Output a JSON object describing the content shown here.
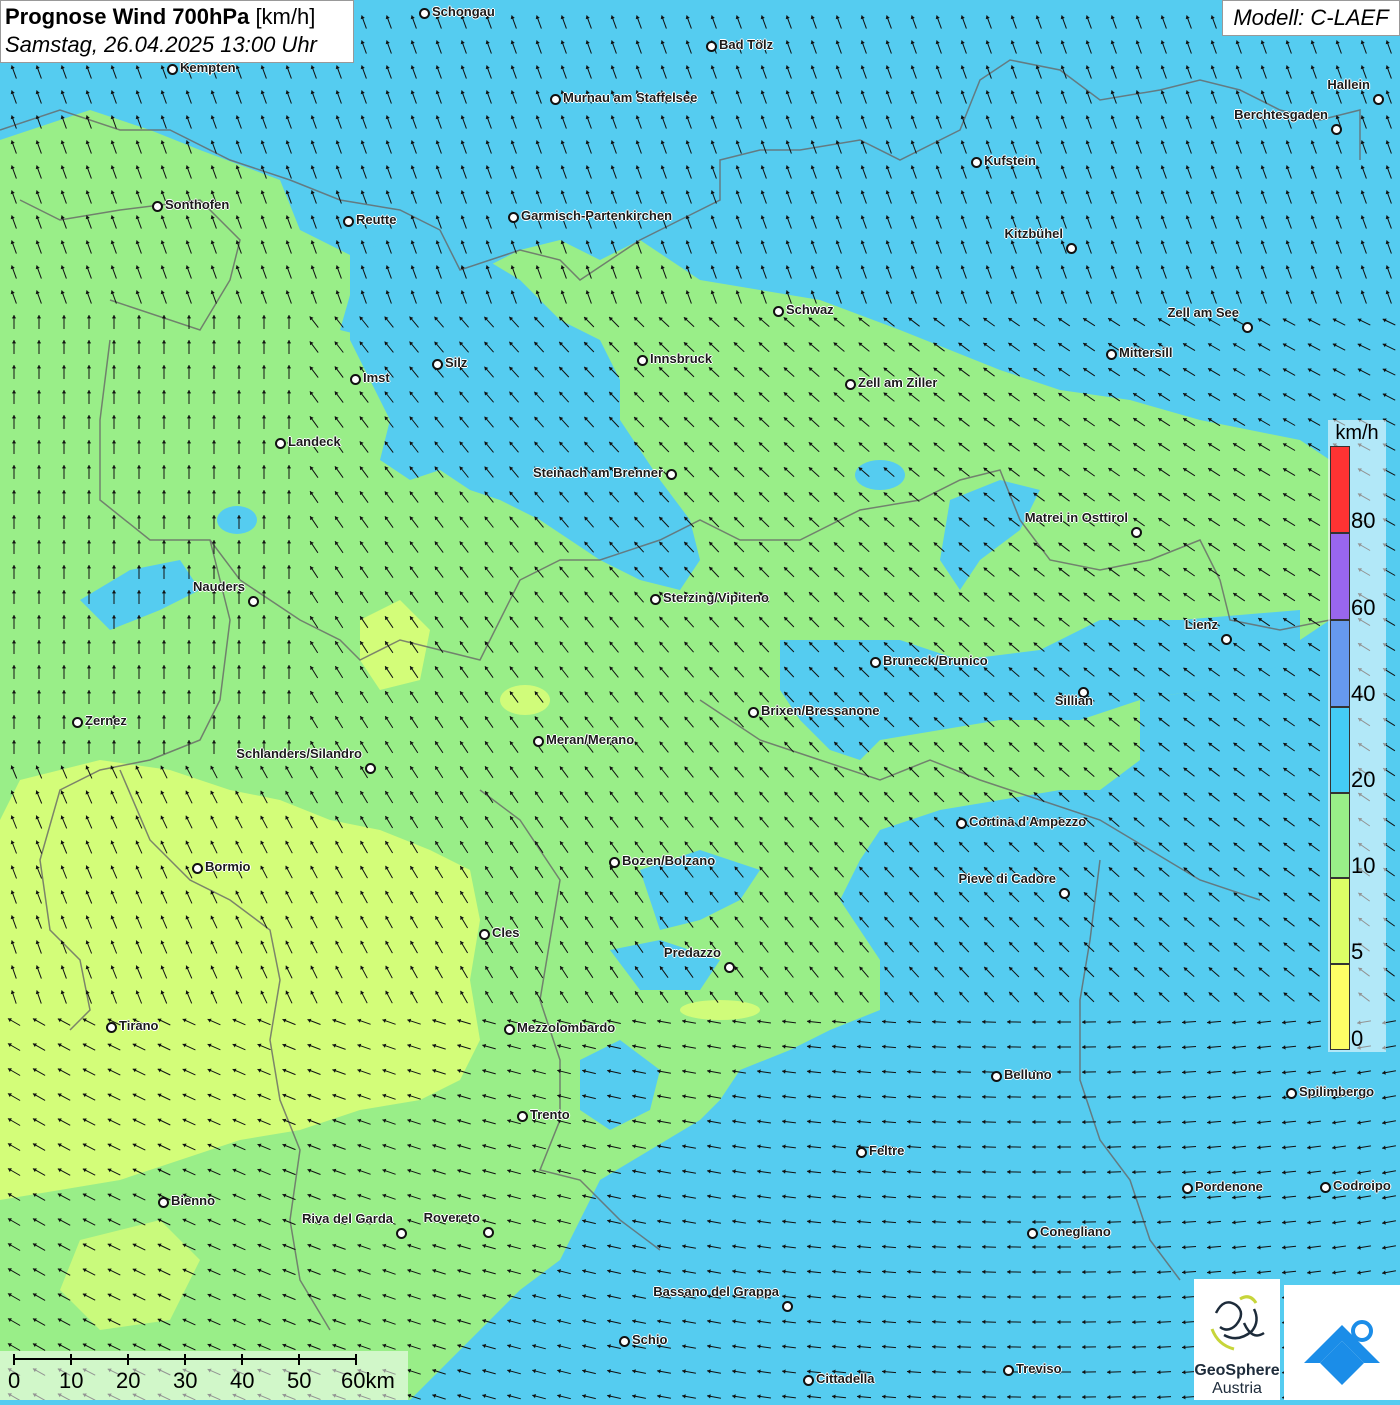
{
  "header": {
    "title_bold": "Prognose Wind 700hPa",
    "title_unit": "[km/h]",
    "datetime": "Samstag, 26.04.2025 13:00 Uhr",
    "model": "Modell: C-LAEF"
  },
  "legend": {
    "unit": "km/h",
    "levels": [
      "80",
      "60",
      "40",
      "20",
      "10",
      "5",
      "0"
    ],
    "colors": {
      "0-5": "#ffff66",
      "5-10": "#ddff66",
      "10-20": "#99ee88",
      "20-40": "#44ccf5",
      "40-60": "#6699ee",
      "60-80": "#9966ee",
      "80+": "#ff3333"
    }
  },
  "scale_bar": {
    "labels": [
      "0",
      "10",
      "20",
      "30",
      "40",
      "50",
      "60km"
    ]
  },
  "logo": {
    "name_line1": "GeoSphere",
    "name_line2": "Austria"
  },
  "cities": [
    {
      "name": "Schongau"
    },
    {
      "name": "Bad Tölz"
    },
    {
      "name": "Kempten"
    },
    {
      "name": "Murnau am Staffelsee"
    },
    {
      "name": "Hallein"
    },
    {
      "name": "Berchtesgaden"
    },
    {
      "name": "Kufstein"
    },
    {
      "name": "Sonthofen"
    },
    {
      "name": "Reutte"
    },
    {
      "name": "Garmisch-Partenkirchen"
    },
    {
      "name": "Kitzbühel"
    },
    {
      "name": "Schwaz"
    },
    {
      "name": "Zell am See"
    },
    {
      "name": "Mittersill"
    },
    {
      "name": "Innsbruck"
    },
    {
      "name": "Silz"
    },
    {
      "name": "Imst"
    },
    {
      "name": "Zell am Ziller"
    },
    {
      "name": "Landeck"
    },
    {
      "name": "Steinach am Brenner"
    },
    {
      "name": "Matrei in Osttirol"
    },
    {
      "name": "Nauders"
    },
    {
      "name": "Sterzing/Vipiteno"
    },
    {
      "name": "Lienz"
    },
    {
      "name": "Bruneck/Brunico"
    },
    {
      "name": "Sillian"
    },
    {
      "name": "Zernez"
    },
    {
      "name": "Brixen/Bressanone"
    },
    {
      "name": "Meran/Merano"
    },
    {
      "name": "Schlanders/Silandro"
    },
    {
      "name": "Cortina d'Ampezzo"
    },
    {
      "name": "Bormio"
    },
    {
      "name": "Bozen/Bolzano"
    },
    {
      "name": "Pieve di Cadore"
    },
    {
      "name": "Cles"
    },
    {
      "name": "Predazzo"
    },
    {
      "name": "Tirano"
    },
    {
      "name": "Mezzolombardo"
    },
    {
      "name": "Belluno"
    },
    {
      "name": "Spilimbergo"
    },
    {
      "name": "Trento"
    },
    {
      "name": "Feltre"
    },
    {
      "name": "Pordenone"
    },
    {
      "name": "Codroipo"
    },
    {
      "name": "Bienno"
    },
    {
      "name": "Riva del Garda"
    },
    {
      "name": "Rovereto"
    },
    {
      "name": "Conegliano"
    },
    {
      "name": "Bassano del Grappa"
    },
    {
      "name": "Schio"
    },
    {
      "name": "Treviso"
    },
    {
      "name": "Cittadella"
    }
  ]
}
